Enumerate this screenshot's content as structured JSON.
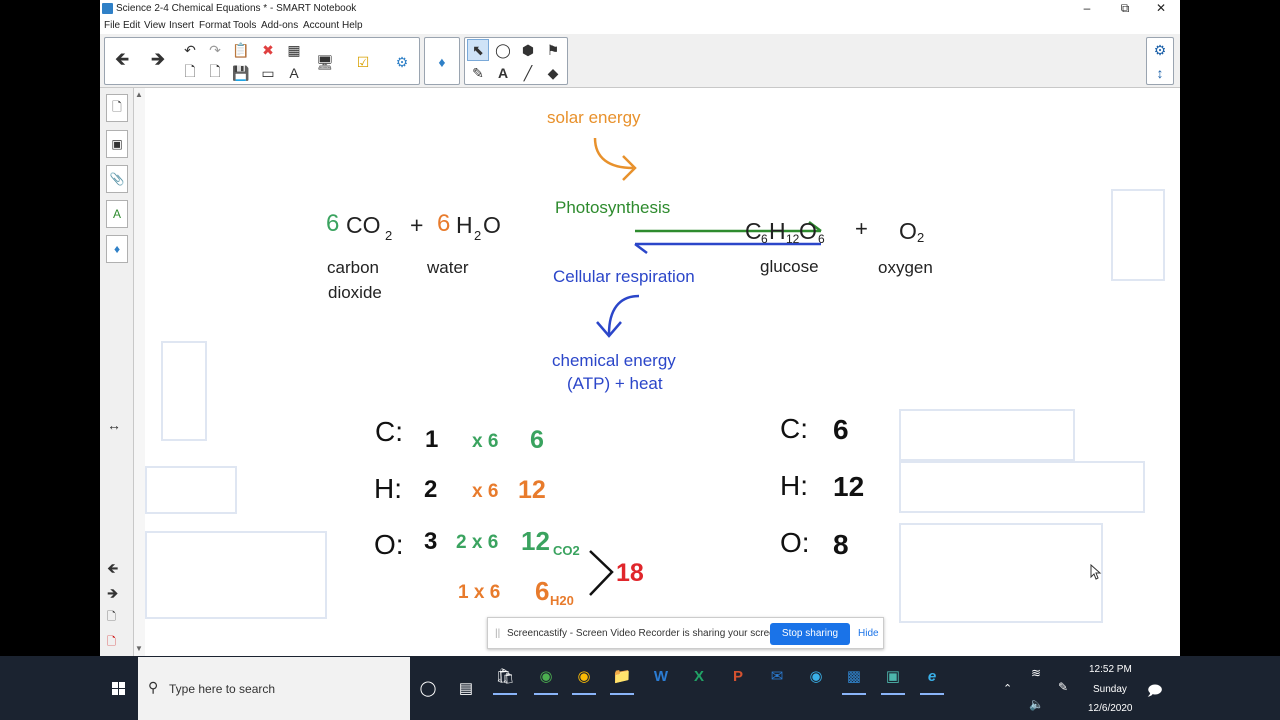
{
  "window": {
    "title": "Science 2-4 Chemical Equations * - SMART Notebook",
    "minimize": "–",
    "maximize": "⧉",
    "close": "✕"
  },
  "menu": [
    "File",
    "Edit",
    "View",
    "Insert",
    "Format",
    "Tools",
    "Add-ons",
    "Account",
    "Help"
  ],
  "toolbar_icons": {
    "back": "back-arrow-icon",
    "forward": "forward-arrow-icon",
    "undo": "undo-icon",
    "redo": "redo-icon",
    "paste": "paste-icon",
    "delete": "delete-icon",
    "table": "table-icon",
    "screen": "screen-shade-icon",
    "select": "select-pointer-icon",
    "pen": "pen-icon",
    "text": "text-icon",
    "line": "line-icon",
    "eraser": "eraser-icon",
    "settings": "gear-icon"
  },
  "equation": {
    "solar_energy": "solar energy",
    "coef_co2": "6",
    "co2": "CO",
    "co2_sub": "2",
    "plus1": "+",
    "coef_h2o": "6",
    "h2o_h": "H",
    "h2o_sub": "2",
    "h2o_o": "O",
    "water": "water",
    "carbon": "carbon",
    "dioxide": "dioxide",
    "photosynthesis": "Photosynthesis",
    "cellular": "Cellular respiration",
    "glucose_c": "C",
    "glucose_sub1": "6",
    "glucose_h": "H",
    "glucose_sub2": "12",
    "glucose_o": "O",
    "glucose_sub3": "6",
    "plus2": "+",
    "o2": "O",
    "o2_sub": "2",
    "glucose": "glucose",
    "oxygen": "oxygen",
    "chem1": "chemical energy",
    "chem2": "(ATP) + heat"
  },
  "left_counts": {
    "c_label": "C:",
    "c_val": "1",
    "c_mult": "x 6",
    "c_total": "6",
    "h_label": "H:",
    "h_val": "2",
    "h_mult": "x 6",
    "h_total": "12",
    "o_label": "O:",
    "o_val": "3",
    "o_mult1": "2 x 6",
    "o_total1": "12",
    "o_total1_sub": "CO2",
    "o_mult2": "1 x 6",
    "o_total2": "6",
    "o_total2_sub": "H20",
    "o_sum": "18"
  },
  "right_counts": {
    "c_label": "C:",
    "c_val": "6",
    "h_label": "H:",
    "h_val": "12",
    "o_label": "O:",
    "o_val": "8"
  },
  "colors": {
    "green": "#3aa35f",
    "orange": "#e87b2c",
    "red": "#e0262b",
    "blue": "#2b46c9",
    "dark_green": "#2e8b2e",
    "solar": "#e8912c"
  },
  "castify": {
    "message": "Screencastify - Screen Video Recorder is sharing your screen.",
    "stop": "Stop sharing",
    "hide": "Hide"
  },
  "taskbar": {
    "search_placeholder": "Type here to search",
    "time": "12:52 PM",
    "day": "Sunday",
    "date": "12/6/2020"
  }
}
